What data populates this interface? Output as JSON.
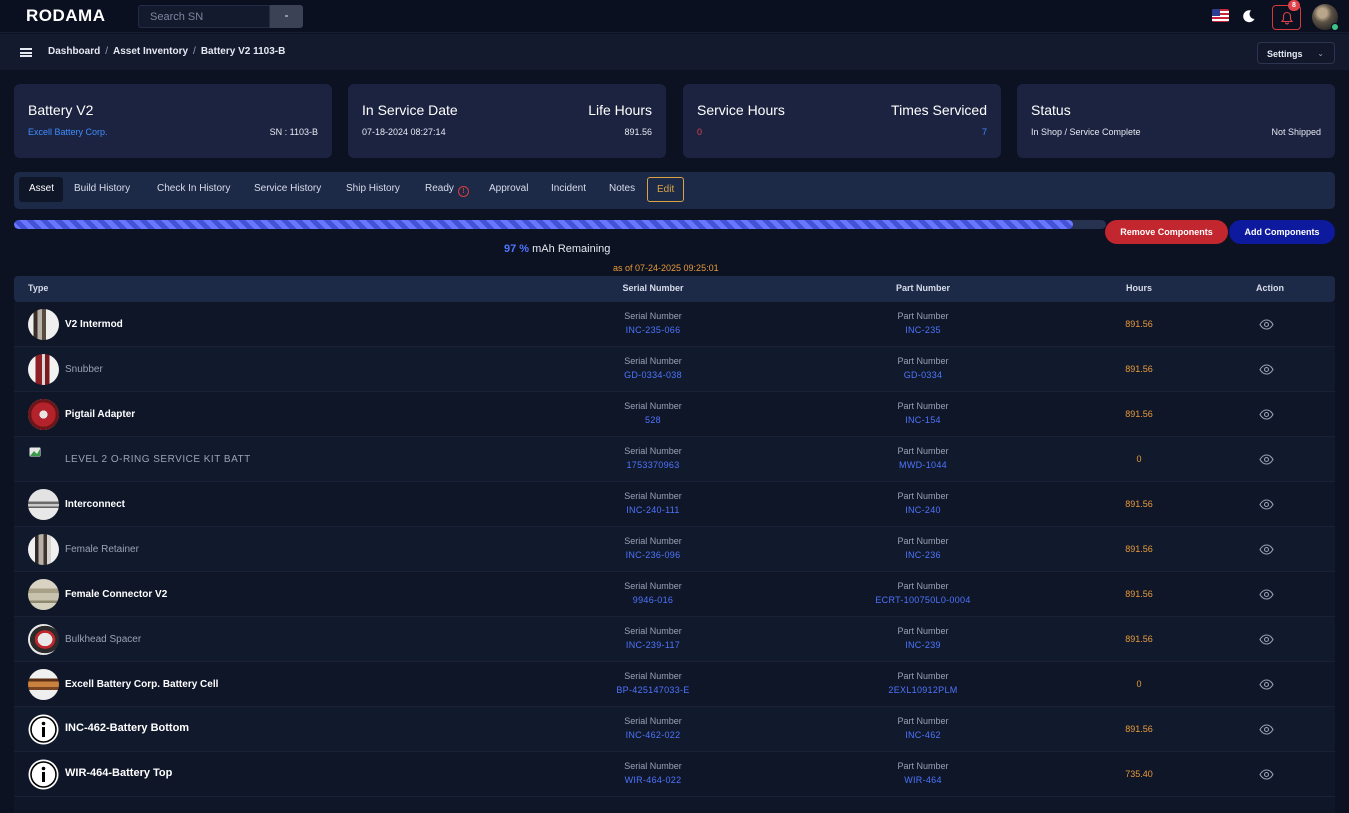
{
  "app": {
    "brand": "RODAMA"
  },
  "topnav": {
    "search_placeholder": "Search SN",
    "notification_count": "8"
  },
  "breadcrumb": [
    "Dashboard",
    "Asset Inventory",
    "Battery V2 1103-B"
  ],
  "settings_label": "Settings",
  "cards": [
    {
      "title": "Battery V2",
      "title_right": "",
      "sub_left": "Excell Battery Corp.",
      "sub_right": "SN : 1103-B"
    },
    {
      "title": "In Service Date",
      "title_right": "Life Hours",
      "sub_left": "07-18-2024 08:27:14",
      "sub_right": "891.56"
    },
    {
      "title": "Service Hours",
      "title_right": "Times Serviced",
      "sub_left": "0",
      "sub_right": "7"
    },
    {
      "title": "Status",
      "title_right": "",
      "sub_left": "In Shop / Service Complete",
      "sub_right": "Not Shipped"
    }
  ],
  "tabs": [
    "Asset",
    "Build History",
    "Check In History",
    "Service History",
    "Ship History",
    "Ready",
    "Approval",
    "Incident",
    "Notes",
    "Edit"
  ],
  "tabs_ready_icon": "!",
  "battery": {
    "percent": 97,
    "percent_label": "97 %",
    "label": "mAh Remaining",
    "as_of": "as of 07-24-2025 09:25:01"
  },
  "actions": {
    "remove": "Remove Components",
    "add": "Add Components"
  },
  "table": {
    "headers": {
      "type": "Type",
      "serial": "Serial Number",
      "part": "Part Number",
      "hours": "Hours",
      "action": "Action"
    },
    "serial_label": "Serial Number",
    "part_label": "Part Number",
    "rows": [
      {
        "type": "V2 Intermod",
        "serial": "INC-235-066",
        "part": "INC-235",
        "hours": "891.56",
        "icon": "v2-intermod-photo"
      },
      {
        "type": "Snubber",
        "serial": "GD-0334-038",
        "part": "GD-0334",
        "hours": "891.56",
        "icon": "snubber-photo"
      },
      {
        "type": "Pigtail Adapter",
        "serial": "528",
        "part": "INC-154",
        "hours": "891.56",
        "icon": "pigtail-adapter-photo"
      },
      {
        "type": "LEVEL 2 O-RING SERVICE KIT BATT",
        "serial": "1753370963",
        "part": "MWD-1044",
        "hours": "0",
        "icon": "broken-image-icon"
      },
      {
        "type": "Interconnect",
        "serial": "INC-240-111",
        "part": "INC-240",
        "hours": "891.56",
        "icon": "interconnect-photo"
      },
      {
        "type": "Female Retainer",
        "serial": "INC-236-096",
        "part": "INC-236",
        "hours": "891.56",
        "icon": "female-retainer-photo"
      },
      {
        "type": "Female Connector V2",
        "serial": "9946-016",
        "part": "ECRT-100750L0-0004",
        "hours": "891.56",
        "icon": "female-connector-photo"
      },
      {
        "type": "Bulkhead Spacer",
        "serial": "INC-239-117",
        "part": "INC-239",
        "hours": "891.56",
        "icon": "bulkhead-spacer-photo"
      },
      {
        "type": "Excell Battery Corp. Battery Cell",
        "serial": "BP-425147033-E",
        "part": "2EXL10912PLM",
        "hours": "0",
        "icon": "battery-cell-photo"
      },
      {
        "type": "INC-462-Battery Bottom",
        "serial": "INC-462-022",
        "part": "INC-462",
        "hours": "891.56",
        "icon": "info-icon"
      },
      {
        "type": "WIR-464-Battery Top",
        "serial": "WIR-464-022",
        "part": "WIR-464",
        "hours": "735.40",
        "icon": "info-icon"
      }
    ]
  }
}
